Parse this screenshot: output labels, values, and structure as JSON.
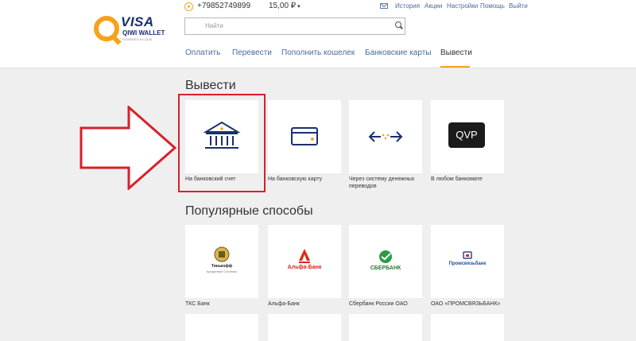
{
  "header": {
    "logo": {
      "brand": "VISA",
      "wallet": "QIWI WALLET",
      "powered": "POWERED BY QIWI"
    },
    "phone": "+79852749899",
    "balance": "15,00 ₽",
    "balance_caret": "▾",
    "top_links": [
      "История",
      "Акции",
      "Настройки",
      "Помощь",
      "Выйти"
    ],
    "search_placeholder": "Найти",
    "nav": [
      "Оплатить",
      "Перевести",
      "Пополнить кошелек",
      "Банковские карты",
      "Вывести"
    ],
    "nav_active": "Вывести"
  },
  "withdraw": {
    "title": "Вывести",
    "options": [
      {
        "label": "На банковский счет",
        "icon": "bank-building-icon"
      },
      {
        "label": "На банковскую карту",
        "icon": "bank-card-icon"
      },
      {
        "label": "Через систему денежных переводов",
        "icon": "transfer-arrows-icon"
      },
      {
        "label": "В любом банкомате",
        "icon": "qvp-icon",
        "badge": "QVP"
      }
    ]
  },
  "popular": {
    "title": "Популярные способы",
    "options": [
      {
        "label": "ТКС Банк",
        "logo_text": "Тинькофф",
        "logo_sub": "Кредитные Системы"
      },
      {
        "label": "Альфа-Банк",
        "logo_text": "Альфа-Банк"
      },
      {
        "label": "Сбербанк России ОАО",
        "logo_text": "СБЕРБАНК"
      },
      {
        "label": "ОАО «ПРОМСВЯЗЬБАНК»",
        "logo_text": "Промсвязьбанк"
      }
    ]
  },
  "colors": {
    "accent": "#f7a21b",
    "link": "#4a6a98",
    "highlight": "#d8202a",
    "brand": "#1a2f6e"
  }
}
